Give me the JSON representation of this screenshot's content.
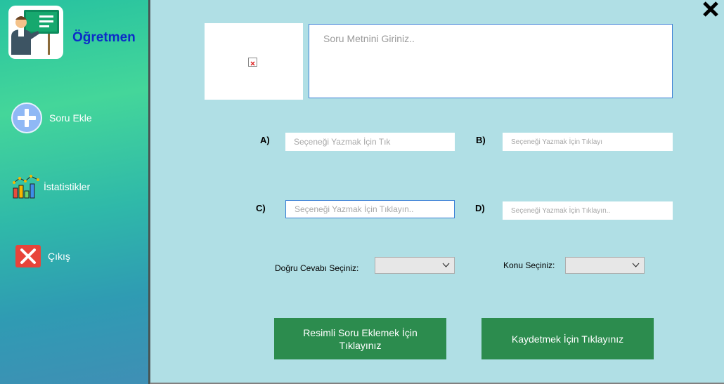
{
  "sidebar": {
    "brand": "Öğretmen",
    "items": [
      {
        "label": "Soru Ekle",
        "icon": "plus-circle-icon"
      },
      {
        "label": "İstatistikler",
        "icon": "bar-chart-icon"
      },
      {
        "label": "Çıkış",
        "icon": "close-square-icon"
      }
    ]
  },
  "form": {
    "question_placeholder": "Soru Metnini Giriniz..",
    "options": [
      {
        "letter": "A)",
        "placeholder": "Seçeneği Yazmak İçin Tık"
      },
      {
        "letter": "B)",
        "placeholder": "Seçeneği Yazmak İçin Tıklayı"
      },
      {
        "letter": "C)",
        "placeholder": "Seçeneği Yazmak İçin Tıklayın.."
      },
      {
        "letter": "D)",
        "placeholder": "Seçeneği Yazmak İçin Tıklayın.."
      }
    ],
    "correct_answer_label": "Doğru Cevabı Seçiniz:",
    "correct_answer_value": "",
    "topic_label": "Konu Seçiniz:",
    "topic_value": "",
    "image_button": "Resimli Soru Eklemek İçin Tıklayınız",
    "save_button": "Kaydetmek İçin Tıklayınız"
  },
  "colors": {
    "accent_blue": "#0c2cc8",
    "button_green": "#2c8c4e",
    "close_red": "#e8443a"
  }
}
